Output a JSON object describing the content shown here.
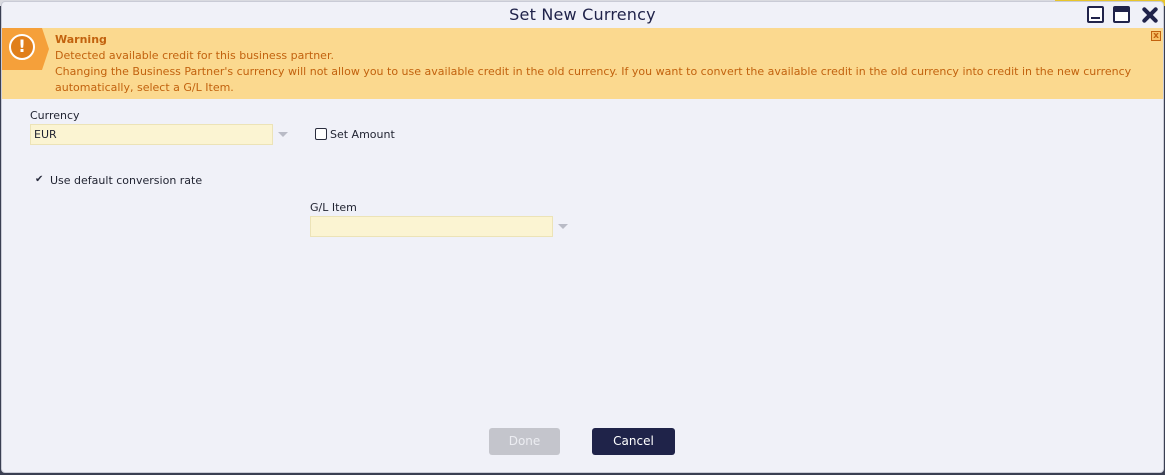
{
  "dialog": {
    "title": "Set New Currency",
    "window_controls": [
      "minimize-icon",
      "maximize-icon",
      "close-icon"
    ]
  },
  "warning": {
    "icon": "exclamation-icon",
    "title": "Warning",
    "line1": "Detected available credit for this business partner.",
    "line2": "Changing the Business Partner's currency will not allow you to use available credit in the old currency. If you want to convert the available credit in the old currency into credit in the new currency",
    "line3": "automatically, select a G/L Item.",
    "close_glyph": "x"
  },
  "form": {
    "currency": {
      "label": "Currency",
      "value": "EUR"
    },
    "set_amount": {
      "label": "Set Amount",
      "checked": false
    },
    "use_default_rate": {
      "label": "Use default conversion rate",
      "checked": true
    },
    "gl_item": {
      "label": "G/L Item",
      "value": ""
    }
  },
  "buttons": {
    "done": "Done",
    "cancel": "Cancel"
  },
  "colors": {
    "warning_bg": "#fbd98f",
    "warning_text": "#c2620e",
    "field_bg": "#fbf4d2",
    "primary_button": "#1f2349",
    "disabled_button": "#c4c5cc",
    "dialog_bg": "#f0f1f8"
  }
}
